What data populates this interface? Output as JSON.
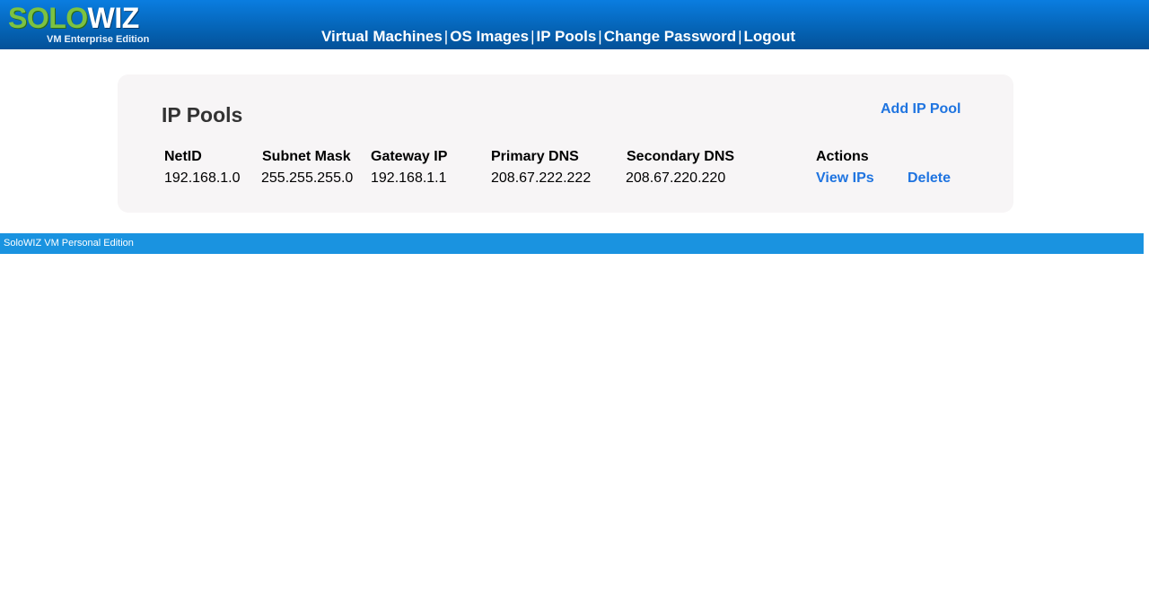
{
  "header": {
    "logo": {
      "part1": "SOLO",
      "part2": "WIZ",
      "edition": "VM Enterprise Edition"
    },
    "nav": [
      {
        "label": "Virtual Machines"
      },
      {
        "label": "OS Images"
      },
      {
        "label": "IP Pools"
      },
      {
        "label": "Change Password"
      },
      {
        "label": "Logout"
      }
    ],
    "separator": "|"
  },
  "main": {
    "title": "IP Pools",
    "add_label": "Add IP Pool",
    "columns": [
      "NetID",
      "Subnet Mask",
      "Gateway IP",
      "Primary DNS",
      "Secondary DNS",
      "Actions"
    ],
    "rows": [
      {
        "netid": "192.168.1.0",
        "subnet": "255.255.255.0",
        "gateway": "192.168.1.1",
        "primary_dns": "208.67.222.222",
        "secondary_dns": "208.67.220.220",
        "view_label": "View IPs",
        "delete_label": "Delete"
      }
    ]
  },
  "footer": {
    "text": "SoloWIZ VM Personal Edition"
  },
  "colors": {
    "header_blue": "#0565b8",
    "link_blue": "#1f74e0",
    "logo_green": "#7cc242",
    "footer_blue": "#1a93e0",
    "panel_bg": "#f7f5f6"
  }
}
